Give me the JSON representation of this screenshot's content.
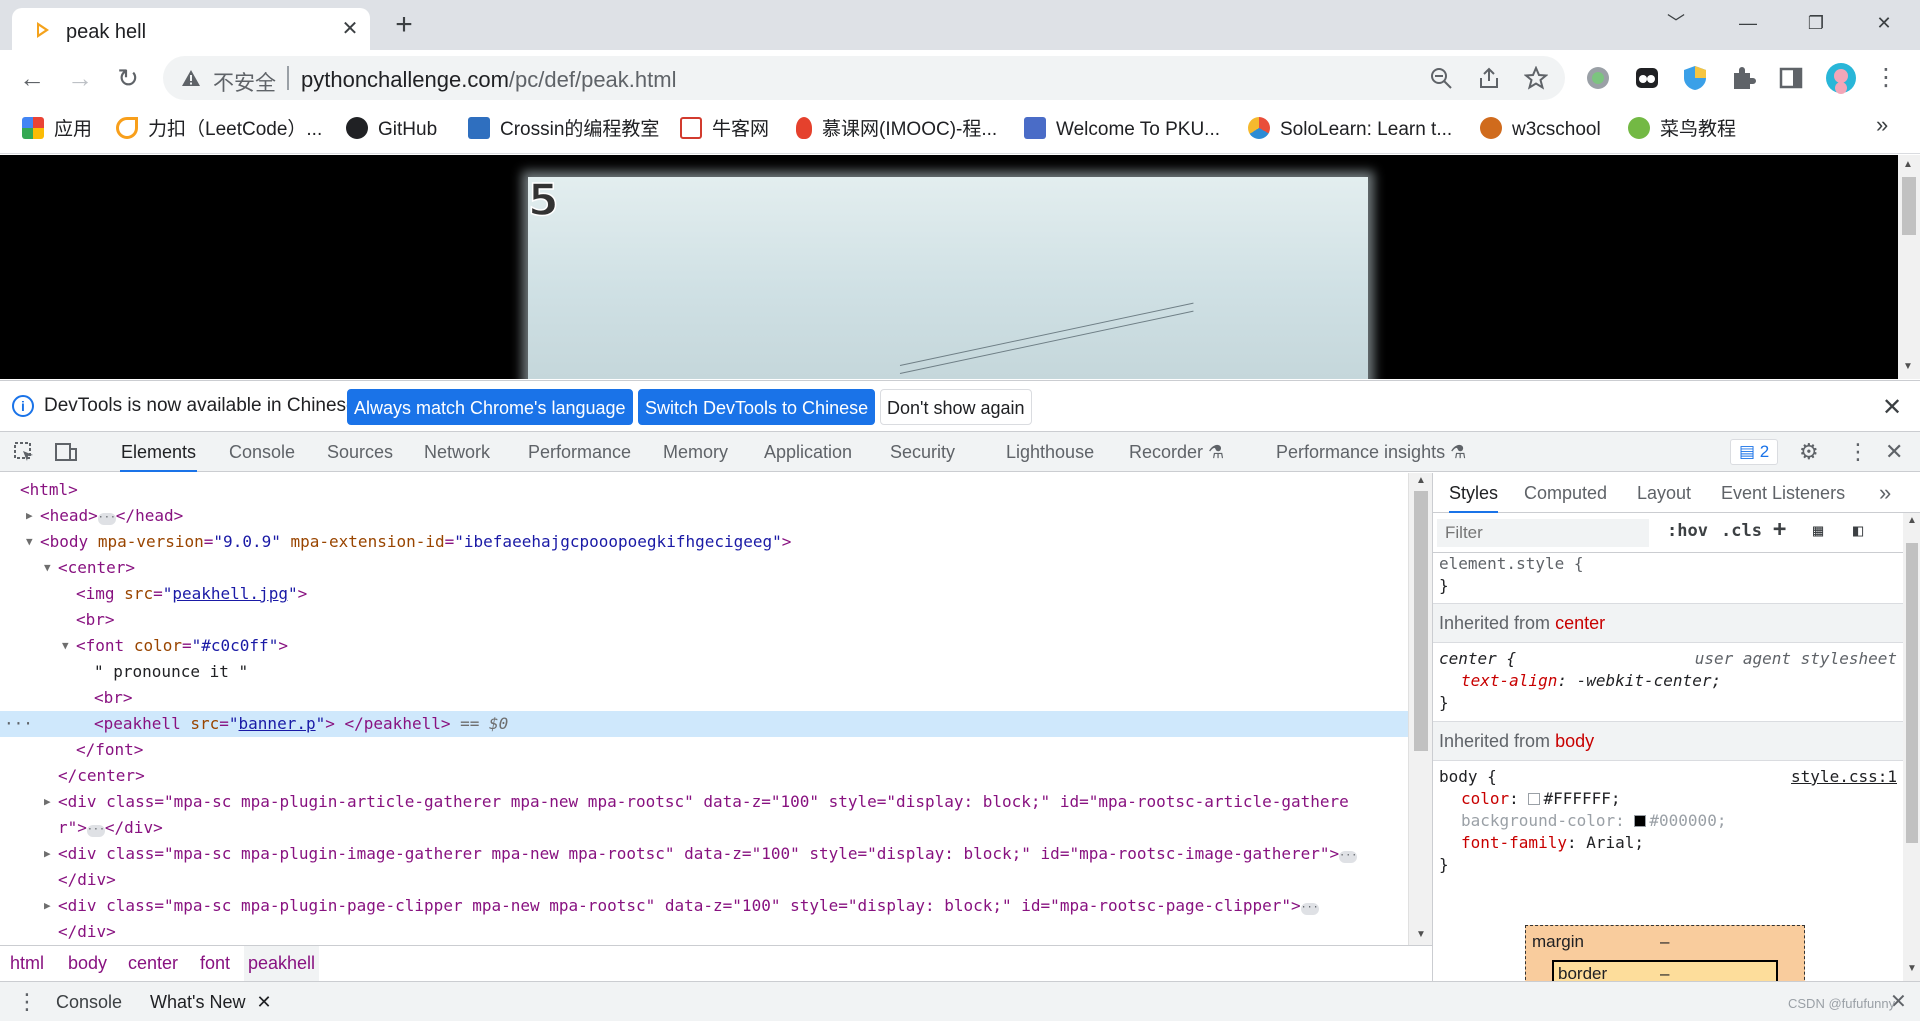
{
  "browser": {
    "tab_title": "peak hell",
    "tab_close": "✕",
    "new_tab": "+",
    "window_controls": [
      "﹀",
      "—",
      "❐",
      "✕"
    ],
    "url_security_text": "不安全",
    "url_host": "pythonchallenge.com",
    "url_path": "/pc/def/peak.html",
    "bookmarks": [
      {
        "label": "应用",
        "icon": "apps-grid-icon",
        "color": "#4285f4"
      },
      {
        "label": "力扣（LeetCode）...",
        "icon": "leetcode-icon",
        "color": "#f89f1b"
      },
      {
        "label": "GitHub",
        "icon": "github-icon",
        "color": "#202124"
      },
      {
        "label": "Crossin的编程教室",
        "icon": "crossin-icon",
        "color": "#2f6fbf"
      },
      {
        "label": "牛客网",
        "icon": "nowcoder-icon",
        "color": "#d23b2e"
      },
      {
        "label": "慕课网(IMOOC)-程...",
        "icon": "imooc-flame-icon",
        "color": "#e5412d"
      },
      {
        "label": "Welcome To PKU...",
        "icon": "poj-icon",
        "color": "#4a6cc7"
      },
      {
        "label": "SoloLearn: Learn t...",
        "icon": "sololearn-icon",
        "color": "#e94e3a"
      },
      {
        "label": "w3cschool",
        "icon": "w3cschool-icon",
        "color": "#d06b1d"
      },
      {
        "label": "菜鸟教程",
        "icon": "runoob-icon",
        "color": "#73b944"
      }
    ],
    "bookmarks_more": "»"
  },
  "page": {
    "image_number": "5"
  },
  "infobar": {
    "message": "DevTools is now available in Chinese!",
    "btn_match": "Always match Chrome's language",
    "btn_switch": "Switch DevTools to Chinese",
    "btn_dismiss": "Don't show again",
    "close": "✕"
  },
  "devtools": {
    "tabs": [
      "Elements",
      "Console",
      "Sources",
      "Network",
      "Performance",
      "Memory",
      "Application",
      "Security",
      "Lighthouse",
      "Recorder",
      "Performance insights"
    ],
    "active_tab": "Elements",
    "issues_count": "2",
    "elements": {
      "html_open": "<html>",
      "head_open": "<head>",
      "head_close": "</head>",
      "body_tag": "<body",
      "body_attr1_name": "mpa-version",
      "body_attr1_value": "\"9.0.9\"",
      "body_attr2_name": "mpa-extension-id",
      "body_attr2_value": "\"ibefaeehajgcpooopoegkifhgecigeeg\"",
      "center_open": "<center>",
      "img_tag": "<img",
      "img_src_name": "src",
      "img_src_value": "peakhell.jpg",
      "br": "<br>",
      "font_tag": "<font",
      "font_attr_name": "color",
      "font_attr_value": "\"#c0c0ff\"",
      "text_node": "\" pronounce it \"",
      "peakhell_tag": "<peakhell",
      "peakhell_src_name": "src",
      "peakhell_src_value": "banner.p",
      "peakhell_close": "</peakhell>",
      "selected_marker": "== $0",
      "font_close": "</font>",
      "center_close": "</center>",
      "div1_line1": "<div class=\"mpa-sc mpa-plugin-article-gatherer mpa-new mpa-rootsc\" data-z=\"100\" style=\"display: block;\" id=\"mpa-rootsc-article-gathere",
      "div1_line2": "r\">",
      "div_close": "</div>",
      "div2": "<div class=\"mpa-sc mpa-plugin-image-gatherer mpa-new mpa-rootsc\" data-z=\"100\" style=\"display: block;\" id=\"mpa-rootsc-image-gatherer\">",
      "div3": "<div class=\"mpa-sc mpa-plugin-page-clipper mpa-new mpa-rootsc\" data-z=\"100\" style=\"display: block;\" id=\"mpa-rootsc-page-clipper\">",
      "ellipsis": "···"
    },
    "breadcrumbs": [
      "html",
      "body",
      "center",
      "font",
      "peakhell"
    ],
    "styles_tabs": [
      "Styles",
      "Computed",
      "Layout",
      "Event Listeners"
    ],
    "styles_more": "»",
    "filter_placeholder": "Filter",
    "hov": ":hov",
    "cls": ".cls",
    "element_style": "element.style {",
    "brace_close": "}",
    "inherited_label": "Inherited from",
    "inherited_center": "center",
    "center_rule_selector": "center {",
    "center_rule_source": "user agent stylesheet",
    "center_prop": "text-align",
    "center_val": "-webkit-center;",
    "inherited_body": "body",
    "body_rule_selector": "body {",
    "body_rule_source": "style.css:1",
    "body_props": [
      {
        "name": "color",
        "value": "#FFFFFF;",
        "swatch": "#FFFFFF",
        "struck": false
      },
      {
        "name": "background-color",
        "value": "#000000;",
        "swatch": "#000000",
        "struck": true
      },
      {
        "name": "font-family",
        "value": "Arial;",
        "swatch": null,
        "struck": false
      }
    ],
    "boxmodel_margin": "margin",
    "boxmodel_border": "border",
    "boxmodel_dash": "–",
    "drawer_tabs": [
      "Console",
      "What's New"
    ],
    "drawer_close": "✕"
  },
  "watermark": "CSDN @fufufunny"
}
